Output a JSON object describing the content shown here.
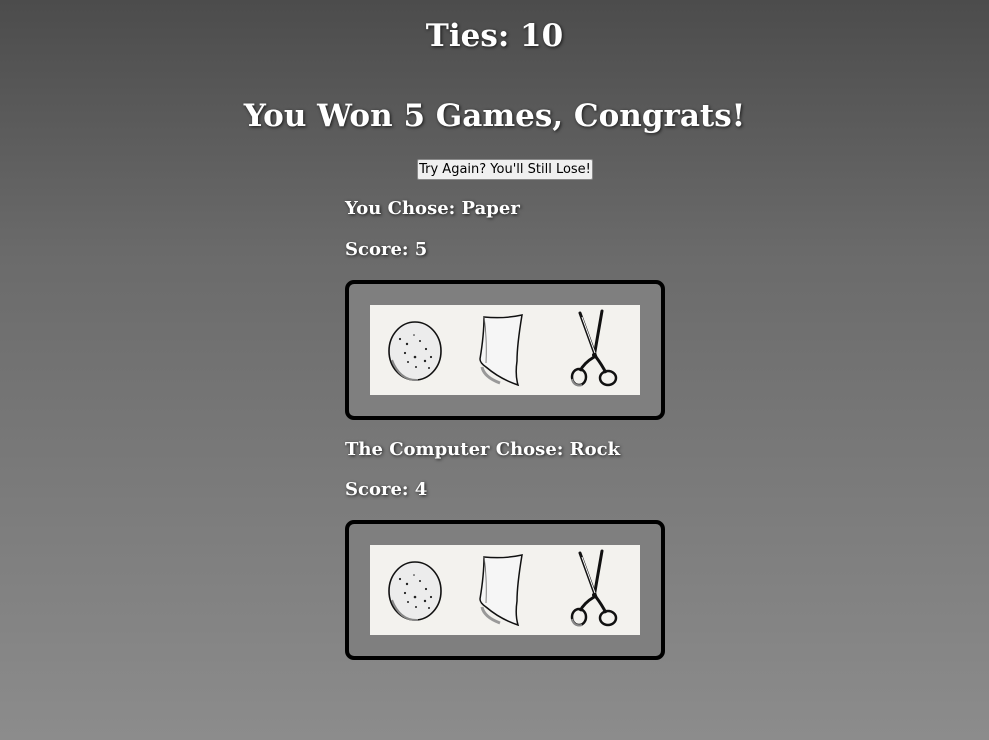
{
  "scoreboard": {
    "ties_text": "Ties: 10"
  },
  "result": {
    "message": "You Won 5 Games, Congrats!",
    "retry_button_label": "Try Again? You'll Still Lose!"
  },
  "player": {
    "choice_text": "You Chose: Paper",
    "score_text": "Score: 5",
    "options": [
      {
        "label": "Rock",
        "icon": "rock-icon"
      },
      {
        "label": "Paper",
        "icon": "paper-icon"
      },
      {
        "label": "Scissors",
        "icon": "scissors-icon"
      }
    ]
  },
  "computer": {
    "choice_text": "The Computer Chose: Rock",
    "score_text": "Score: 4",
    "options": [
      {
        "label": "Rock",
        "icon": "rock-icon"
      },
      {
        "label": "Paper",
        "icon": "paper-icon"
      },
      {
        "label": "Scissors",
        "icon": "scissors-icon"
      }
    ]
  },
  "colors": {
    "text": "#ffffff",
    "board_border": "#000000",
    "board_fill": "#7f7f7f",
    "strip_fill": "#f3f2ee"
  }
}
